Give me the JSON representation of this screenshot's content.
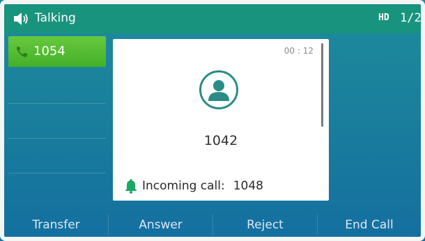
{
  "status_bar": {
    "title": "Talking",
    "hd_badge": "HD",
    "page_indicator": "1/2"
  },
  "line": {
    "number": "1054"
  },
  "call_card": {
    "timer": "00 : 12",
    "callee_number": "1042",
    "incoming_label": "Incoming call:",
    "incoming_number": "1048"
  },
  "softkeys": [
    {
      "label": "Transfer"
    },
    {
      "label": "Answer"
    },
    {
      "label": "Reject"
    },
    {
      "label": "End Call"
    }
  ],
  "colors": {
    "status_bar": "#18937e",
    "line_key": "#52bd2f",
    "accent_teal": "#2a8c86"
  }
}
